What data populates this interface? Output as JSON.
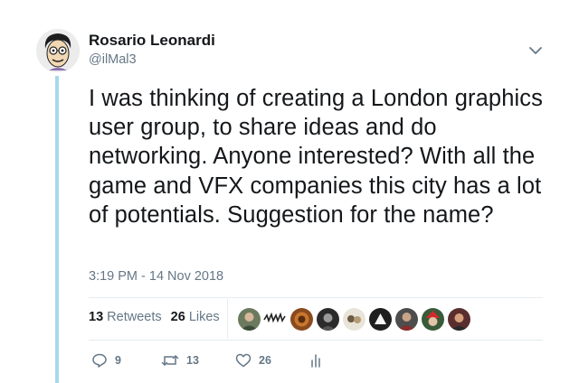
{
  "author": {
    "name": "Rosario Leonardi",
    "handle": "@ilMal3",
    "avatar_icon": "cartoon-portrait-avatar"
  },
  "tweet": {
    "text": "I was thinking of creating a London graphics user group, to share ideas and do networking. Anyone interested? With all the game and VFX companies this city has a lot of potentials. Suggestion for the name?",
    "timestamp": "3:19 PM - 14 Nov 2018"
  },
  "stats": {
    "retweets_count": "13",
    "retweets_label": "Retweets",
    "likes_count": "26",
    "likes_label": "Likes"
  },
  "likers": [
    "liker-1",
    "liker-2",
    "liker-3",
    "liker-4",
    "liker-5",
    "liker-6",
    "liker-7",
    "liker-8",
    "liker-9"
  ],
  "actions": {
    "reply_count": "9",
    "retweet_count": "13",
    "like_count": "26"
  },
  "colors": {
    "text": "#14171a",
    "secondary": "#657786",
    "thread_line": "#a7d8ec",
    "divider": "#e6ecf0"
  }
}
